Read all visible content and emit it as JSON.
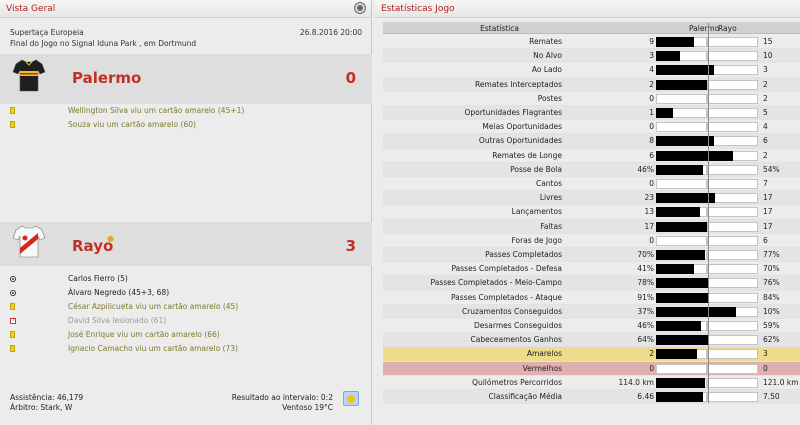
{
  "left_panel": {
    "title": "Vista Geral",
    "competition": "Supertaça Europeia",
    "datetime": "26.8.2016 20:00",
    "venue": "Final do Jogo no Signal Iduna Park , em Dortmund",
    "home": {
      "name": "Palermo",
      "score": "0"
    },
    "away": {
      "name": "Rayo",
      "score": "3"
    },
    "home_events": [
      {
        "type": "yellow",
        "text": "Wellington Silva viu um cartão amarelo (45+1)"
      },
      {
        "type": "yellow",
        "text": "Souza viu um cartão amarelo (60)"
      }
    ],
    "away_events": [
      {
        "type": "goal",
        "text": "Carlos Fierro (5)"
      },
      {
        "type": "goal",
        "text": "Álvaro Negredo (45+3, 68)"
      },
      {
        "type": "yellow",
        "text": "César Azpilicueta viu um cartão amarelo (45)"
      },
      {
        "type": "injury",
        "text": "David Silva lesionado (61)"
      },
      {
        "type": "yellow",
        "text": "José Enrique viu um cartão amarelo (66)"
      },
      {
        "type": "yellow",
        "text": "Ignacio Camacho viu um cartão amarelo (73)"
      }
    ],
    "attendance": "Assistência: 46,179",
    "referee": "Árbitro: Stark, W",
    "halftime": "Resultado ao intervalo: 0:2",
    "wind": "Ventoso 19°C"
  },
  "right_panel": {
    "title": "Estatísticas Jogo",
    "col_stat": "Estatística",
    "col_home": "Palermo",
    "col_away": "Rayo",
    "rows": [
      {
        "label": "Remates",
        "home": "9",
        "away": "15",
        "hv": 9,
        "av": 15
      },
      {
        "label": "No Alvo",
        "home": "3",
        "away": "10",
        "hv": 3,
        "av": 10
      },
      {
        "label": "Ao Lado",
        "home": "4",
        "away": "3",
        "hv": 4,
        "av": 3
      },
      {
        "label": "Remates Interceptados",
        "home": "2",
        "away": "2",
        "hv": 2,
        "av": 2
      },
      {
        "label": "Postes",
        "home": "0",
        "away": "2",
        "hv": 0,
        "av": 2
      },
      {
        "label": "Oportunidades Flagrantes",
        "home": "1",
        "away": "5",
        "hv": 1,
        "av": 5
      },
      {
        "label": "Meias Oportunidades",
        "home": "0",
        "away": "4",
        "hv": 0,
        "av": 4
      },
      {
        "label": "Outras Oportunidades",
        "home": "8",
        "away": "6",
        "hv": 8,
        "av": 6
      },
      {
        "label": "Remates de Longe",
        "home": "6",
        "away": "2",
        "hv": 6,
        "av": 2
      },
      {
        "label": "Posse de Bola",
        "home": "46%",
        "away": "54%",
        "hv": 46,
        "av": 54
      },
      {
        "label": "Cantos",
        "home": "0",
        "away": "7",
        "hv": 0,
        "av": 7
      },
      {
        "label": "Livres",
        "home": "23",
        "away": "17",
        "hv": 23,
        "av": 17
      },
      {
        "label": "Lançamentos",
        "home": "13",
        "away": "17",
        "hv": 13,
        "av": 17
      },
      {
        "label": "Faltas",
        "home": "17",
        "away": "17",
        "hv": 17,
        "av": 17
      },
      {
        "label": "Foras de Jogo",
        "home": "0",
        "away": "6",
        "hv": 0,
        "av": 6
      },
      {
        "label": "Passes Completados",
        "home": "70%",
        "away": "77%",
        "hv": 70,
        "av": 77
      },
      {
        "label": "Passes Completados - Defesa",
        "home": "41%",
        "away": "70%",
        "hv": 41,
        "av": 70
      },
      {
        "label": "Passes Completados - Meio-Campo",
        "home": "78%",
        "away": "76%",
        "hv": 78,
        "av": 76
      },
      {
        "label": "Passes Completados - Ataque",
        "home": "91%",
        "away": "84%",
        "hv": 91,
        "av": 84
      },
      {
        "label": "Cruzamentos Conseguidos",
        "home": "37%",
        "away": "10%",
        "hv": 37,
        "av": 10
      },
      {
        "label": "Desarmes Conseguidos",
        "home": "46%",
        "away": "59%",
        "hv": 46,
        "av": 59
      },
      {
        "label": "Cabeceamentos Ganhos",
        "home": "64%",
        "away": "62%",
        "hv": 64,
        "av": 62
      },
      {
        "label": "Amarelos",
        "home": "2",
        "away": "3",
        "hv": 2,
        "av": 3,
        "hl": "yellow"
      },
      {
        "label": "Vermelhos",
        "home": "0",
        "away": "0",
        "hv": 0,
        "av": 0,
        "hl": "red"
      },
      {
        "label": "Quilómetros Percorridos",
        "home": "114.0 km",
        "away": "121.0 km",
        "hv": 114,
        "av": 121
      },
      {
        "label": "Classificação Média",
        "home": "6.46",
        "away": "7.50",
        "hv": 6.46,
        "av": 7.5
      }
    ]
  }
}
